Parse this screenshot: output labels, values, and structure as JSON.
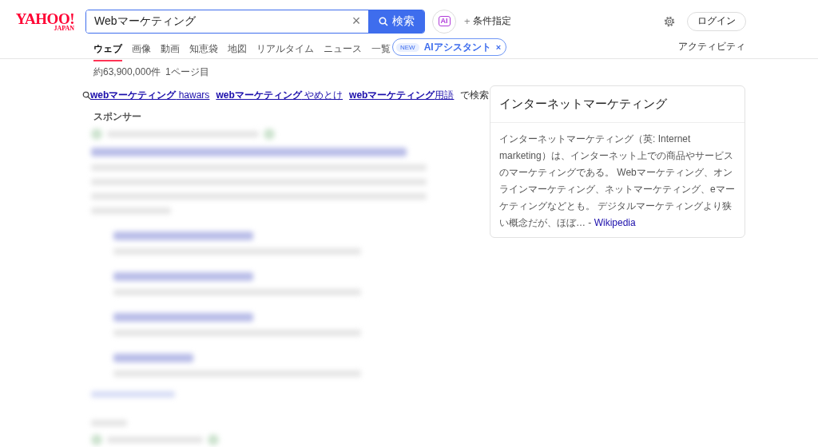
{
  "logo": {
    "text": "YAHOO!",
    "sub": "JAPAN"
  },
  "search": {
    "value": "Webマーケティング",
    "clear": "×",
    "button": "検索"
  },
  "ai_button": {
    "label": "AI"
  },
  "filter_link": {
    "icon": "+",
    "label": "条件指定"
  },
  "login_button": "ログイン",
  "tabs": [
    {
      "label": "ウェブ",
      "selected": true
    },
    {
      "label": "画像",
      "selected": false
    },
    {
      "label": "動画",
      "selected": false
    },
    {
      "label": "知恵袋",
      "selected": false
    },
    {
      "label": "地図",
      "selected": false
    },
    {
      "label": "リアルタイム",
      "selected": false
    },
    {
      "label": "ニュース",
      "selected": false
    },
    {
      "label": "一覧",
      "selected": false
    }
  ],
  "ai_tooltip": {
    "badge": "NEW",
    "label": "AIアシスタント",
    "close": "×"
  },
  "activity_link": "アクティビティ",
  "result_count": "約63,900,000件",
  "page_number": "1ページ目",
  "related_searches": {
    "items": [
      "**webマーケティング** hawars",
      "**webマーケティング** やめとけ",
      "**webマーケティング**用語"
    ],
    "suffix": "で検索"
  },
  "sponsor_label": "スポンサー",
  "knowledge_panel": {
    "title": "インターネットマーケティング",
    "summary": "インターネットマーケティング（英: Internet marketing）は、インターネット上での商品やサービスのマーケティングである。 Webマーケティング、オンラインマーケティング、ネットマーケティング、eマーケティングなどとも。 デジタルマーケティングより狭い概念だが、ほぼ… -",
    "source": "Wikipedia"
  }
}
